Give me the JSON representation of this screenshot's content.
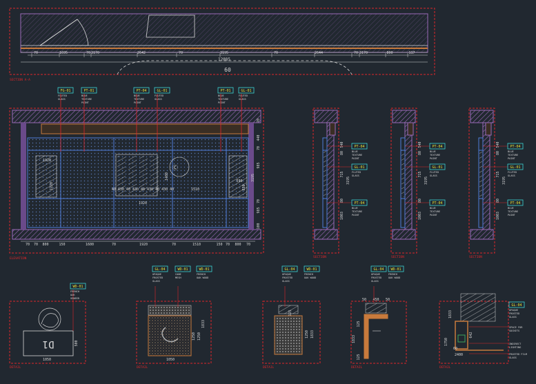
{
  "colors": {
    "background": "#212830",
    "frame_red": "#e0262a",
    "wall_purple": "#9b6ab8",
    "dim_white": "#d8d8d8",
    "line_blue": "#4e7cd8",
    "tag_cyan": "#3cd6d6",
    "tag_yellow": "#e8e33a",
    "wood_orange": "#c87a3c",
    "green_line": "#3aa35a"
  },
  "top_plan": {
    "dims": [
      "70",
      "1695",
      "70",
      "3170",
      "2642",
      "70",
      "3195",
      "70",
      "2644",
      "70",
      "3170",
      "800",
      "117"
    ],
    "total": "12885",
    "label_fragment": "60"
  },
  "main_elevation": {
    "tags": [
      "FG-01",
      "PT-01",
      "PT-04",
      "GL-01",
      "PT-01",
      "GL-01"
    ],
    "notes": [
      "FLUTED GLASS",
      "BLUE TEXTURE PAINT",
      "BLUE TEXTURE PAINT",
      "FLUTED GLASS",
      "BLUE TEXTURE PAINT",
      "FLUTED GLASS"
    ],
    "dims_bottom": [
      "70",
      "70",
      "800",
      "150",
      "1600",
      "70",
      "1920",
      "70",
      "1510",
      "150",
      "70",
      "800",
      "70"
    ],
    "dims_right": [
      "70",
      "440",
      "70",
      "985",
      "70",
      "985",
      "100"
    ],
    "total_right": "3195",
    "inner_labels": [
      "1920",
      "1220",
      "40 430 40 430 40 430 40 430 40",
      "1480",
      "1510",
      "590",
      "830",
      "1920"
    ]
  },
  "sections": [
    {
      "tags": [
        "PT-04",
        "GL-01",
        "PT-04"
      ],
      "notes": [
        "BLUE TEXTURE PAINT",
        "FLUTED GLASS",
        "BLUE TEXTURE PAINT"
      ],
      "dims": [
        "540",
        "80",
        "715",
        "80",
        "1003"
      ],
      "total": "3195"
    },
    {
      "tags": [
        "PT-04",
        "GL-01",
        "PT-04"
      ],
      "notes": [
        "BLUE TEXTURE PAINT",
        "FLUTED GLASS",
        "BLUE TEXTURE PAINT"
      ],
      "dims": [
        "540",
        "80",
        "715",
        "80",
        "1003"
      ],
      "total": "3195"
    },
    {
      "tags": [
        "PT-04",
        "GL-01",
        "PT-04"
      ],
      "notes": [
        "BLUE TEXTURE PAINT",
        "FLUTED GLASS",
        "BLUE TEXTURE PAINT"
      ],
      "dims": [
        "540",
        "80",
        "715",
        "80",
        "1003"
      ],
      "total": "3195"
    }
  ],
  "details": [
    {
      "tags": [
        "WD-01"
      ],
      "notes": [
        "FRENCH OAK VENEER"
      ],
      "dims": [
        "1050",
        "500"
      ],
      "sign": "D1"
    },
    {
      "tags": [
        "GL-04",
        "WD-01",
        "WD-01"
      ],
      "notes": [
        "OPAQUE FROSTED GLASS",
        "CANE MESH",
        "FRENCH OAK WOOD"
      ],
      "dims": [
        "1050",
        "1833",
        "1250",
        "1250"
      ]
    },
    {
      "tags": [
        "GL-04",
        "WD-01"
      ],
      "notes": [
        "OPAQUE FROSTED GLASS",
        "FRENCH OAK WOOD"
      ],
      "dims": [
        "125",
        "1250",
        "1833"
      ]
    },
    {
      "tags": [
        "GL-04",
        "WD-01"
      ],
      "notes": [
        "OPAQUE FROSTED GLASS",
        "FRENCH OAK WOOD"
      ],
      "dims": [
        "50",
        "450",
        "50",
        "1833",
        "125",
        "125"
      ]
    },
    {
      "tags": [
        "GL-04"
      ],
      "notes": [
        "OPAQUE FROSTED GLASS",
        "SPACE FOR SOCKETS",
        "INDIRECT LIGHTING",
        "FROSTED FILM GLASS"
      ],
      "dims": [
        "1833",
        "642",
        "1750",
        "2400",
        "60"
      ]
    }
  ],
  "frame_titles": [
    "SECTION A-A",
    "ELEVATION",
    "SECTION",
    "SECTION",
    "SECTION",
    "DETAIL",
    "DETAIL",
    "DETAIL",
    "DETAIL",
    "DETAIL"
  ]
}
